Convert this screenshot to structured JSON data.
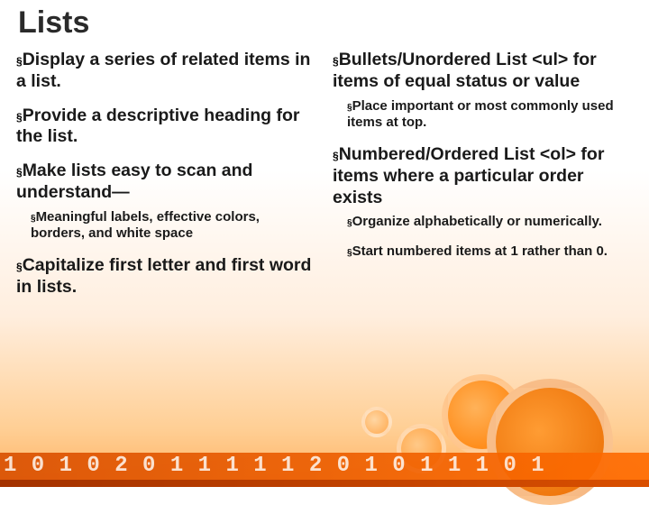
{
  "title": "Lists",
  "bullet": "§",
  "left": [
    {
      "text": "Display a series of related items in a list."
    },
    {
      "text": "Provide a descriptive heading for the list."
    },
    {
      "text": "Make lists easy to scan and understand—",
      "sub": [
        {
          "text": "Meaningful labels, effective colors, borders, and white space"
        }
      ]
    },
    {
      "text": "Capitalize first letter and first word in lists."
    }
  ],
  "right": [
    {
      "text": "Bullets/Unordered List <ul> for items of equal status or value",
      "sub": [
        {
          "text": "Place important or most commonly used items at top."
        }
      ]
    },
    {
      "text": "Numbered/Ordered List <ol> for items where a particular order exists",
      "sub": [
        {
          "text": "Organize alphabetically or numerically."
        },
        {
          "text": "Start numbered items at 1 rather than 0."
        }
      ]
    }
  ],
  "deco_digits": "1 0 1 0 2 0 1 1 1 1 1 2 0 1 0 1 1 1 0 1"
}
